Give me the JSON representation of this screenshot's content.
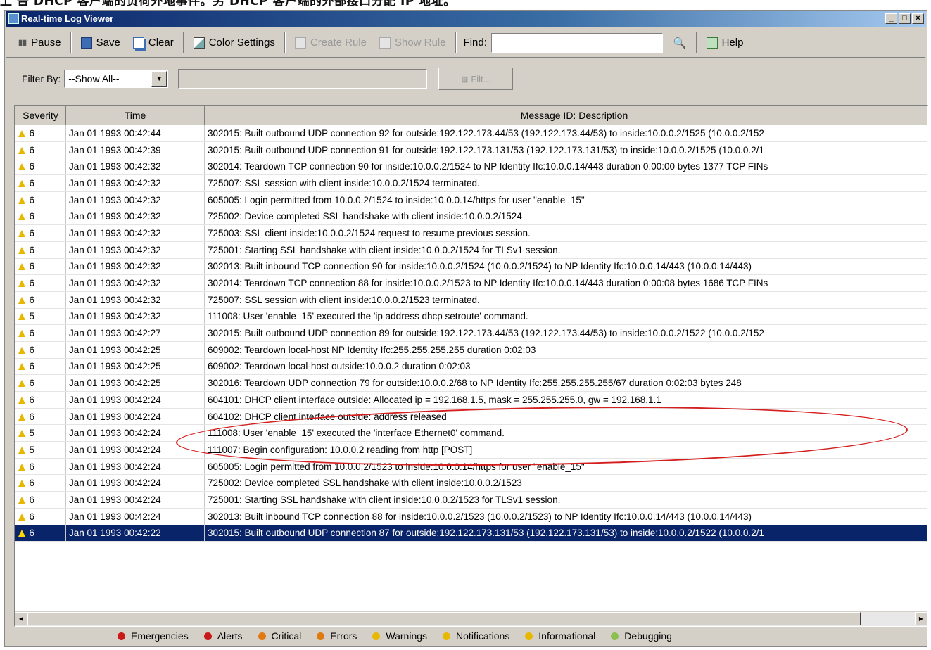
{
  "caption": "上 告 DHCP 客户端的负荷外地事件。另 DHCP 客户端的外部接口分配 IP 地址。",
  "window": {
    "title": "Real-time Log Viewer"
  },
  "toolbar": {
    "pause": "Pause",
    "save": "Save",
    "clear": "Clear",
    "color_settings": "Color Settings",
    "create_rule": "Create Rule",
    "show_rule": "Show Rule",
    "find_label": "Find:",
    "find_value": "",
    "help": "Help"
  },
  "filter": {
    "label": "Filter By:",
    "selected": "--Show All--",
    "text_value": "",
    "button": "Filt..."
  },
  "table": {
    "columns": [
      "Severity",
      "Time",
      "Message ID: Description"
    ],
    "rows": [
      {
        "sev": "6",
        "time": "Jan 01 1993 00:42:44",
        "msg": "302015: Built outbound UDP connection 92 for outside:192.122.173.44/53 (192.122.173.44/53) to inside:10.0.0.2/1525 (10.0.0.2/152"
      },
      {
        "sev": "6",
        "time": "Jan 01 1993 00:42:39",
        "msg": "302015: Built outbound UDP connection 91 for outside:192.122.173.131/53 (192.122.173.131/53) to inside:10.0.0.2/1525 (10.0.0.2/1"
      },
      {
        "sev": "6",
        "time": "Jan 01 1993 00:42:32",
        "msg": "302014: Teardown TCP connection 90 for inside:10.0.0.2/1524 to NP Identity Ifc:10.0.0.14/443 duration 0:00:00 bytes 1377 TCP FINs"
      },
      {
        "sev": "6",
        "time": "Jan 01 1993 00:42:32",
        "msg": "725007: SSL session with client inside:10.0.0.2/1524 terminated."
      },
      {
        "sev": "6",
        "time": "Jan 01 1993 00:42:32",
        "msg": "605005: Login permitted from 10.0.0.2/1524 to inside:10.0.0.14/https for user \"enable_15\""
      },
      {
        "sev": "6",
        "time": "Jan 01 1993 00:42:32",
        "msg": "725002: Device completed SSL handshake with client inside:10.0.0.2/1524"
      },
      {
        "sev": "6",
        "time": "Jan 01 1993 00:42:32",
        "msg": "725003: SSL client inside:10.0.0.2/1524 request to resume previous session."
      },
      {
        "sev": "6",
        "time": "Jan 01 1993 00:42:32",
        "msg": "725001: Starting SSL handshake with client inside:10.0.0.2/1524 for TLSv1 session."
      },
      {
        "sev": "6",
        "time": "Jan 01 1993 00:42:32",
        "msg": "302013: Built inbound TCP connection 90 for inside:10.0.0.2/1524 (10.0.0.2/1524) to NP Identity Ifc:10.0.0.14/443 (10.0.0.14/443)"
      },
      {
        "sev": "6",
        "time": "Jan 01 1993 00:42:32",
        "msg": "302014: Teardown TCP connection 88 for inside:10.0.0.2/1523 to NP Identity Ifc:10.0.0.14/443 duration 0:00:08 bytes 1686 TCP FINs"
      },
      {
        "sev": "6",
        "time": "Jan 01 1993 00:42:32",
        "msg": "725007: SSL session with client inside:10.0.0.2/1523 terminated."
      },
      {
        "sev": "5",
        "time": "Jan 01 1993 00:42:32",
        "msg": "111008: User 'enable_15' executed the 'ip address dhcp setroute' command."
      },
      {
        "sev": "6",
        "time": "Jan 01 1993 00:42:27",
        "msg": "302015: Built outbound UDP connection 89 for outside:192.122.173.44/53 (192.122.173.44/53) to inside:10.0.0.2/1522 (10.0.0.2/152"
      },
      {
        "sev": "6",
        "time": "Jan 01 1993 00:42:25",
        "msg": "609002: Teardown local-host NP Identity Ifc:255.255.255.255 duration 0:02:03"
      },
      {
        "sev": "6",
        "time": "Jan 01 1993 00:42:25",
        "msg": "609002: Teardown local-host outside:10.0.0.2 duration 0:02:03"
      },
      {
        "sev": "6",
        "time": "Jan 01 1993 00:42:25",
        "msg": "302016: Teardown UDP connection 79 for outside:10.0.0.2/68 to NP Identity Ifc:255.255.255.255/67 duration 0:02:03 bytes 248"
      },
      {
        "sev": "6",
        "time": "Jan 01 1993 00:42:24",
        "msg": "604101: DHCP client interface outside: Allocated ip = 192.168.1.5, mask = 255.255.255.0, gw = 192.168.1.1"
      },
      {
        "sev": "6",
        "time": "Jan 01 1993 00:42:24",
        "msg": "604102: DHCP client interface outside:  address released"
      },
      {
        "sev": "5",
        "time": "Jan 01 1993 00:42:24",
        "msg": "111008: User 'enable_15' executed the 'interface Ethernet0' command."
      },
      {
        "sev": "5",
        "time": "Jan 01 1993 00:42:24",
        "msg": "111007: Begin configuration: 10.0.0.2 reading from http [POST]"
      },
      {
        "sev": "6",
        "time": "Jan 01 1993 00:42:24",
        "msg": "605005: Login permitted from 10.0.0.2/1523 to inside:10.0.0.14/https for user \"enable_15\""
      },
      {
        "sev": "6",
        "time": "Jan 01 1993 00:42:24",
        "msg": "725002: Device completed SSL handshake with client inside:10.0.0.2/1523"
      },
      {
        "sev": "6",
        "time": "Jan 01 1993 00:42:24",
        "msg": "725001: Starting SSL handshake with client inside:10.0.0.2/1523 for TLSv1 session."
      },
      {
        "sev": "6",
        "time": "Jan 01 1993 00:42:24",
        "msg": "302013: Built inbound TCP connection 88 for inside:10.0.0.2/1523 (10.0.0.2/1523) to NP Identity Ifc:10.0.0.14/443 (10.0.0.14/443)"
      },
      {
        "sev": "6",
        "time": "Jan 01 1993 00:42:22",
        "msg": "302015: Built outbound UDP connection 87 for outside:192.122.173.131/53 (192.122.173.131/53) to inside:10.0.0.2/1522 (10.0.0.2/1"
      }
    ]
  },
  "legend": [
    {
      "label": "Emergencies",
      "color": "#c81818"
    },
    {
      "label": "Alerts",
      "color": "#c81818"
    },
    {
      "label": "Critical",
      "color": "#e07a10"
    },
    {
      "label": "Errors",
      "color": "#e07a10"
    },
    {
      "label": "Warnings",
      "color": "#e8b800"
    },
    {
      "label": "Notifications",
      "color": "#e8b800"
    },
    {
      "label": "Informational",
      "color": "#e8b800"
    },
    {
      "label": "Debugging",
      "color": "#8cbf50"
    }
  ],
  "colors": {
    "selection": "#0a246a",
    "annotation": "#d51e1e"
  }
}
